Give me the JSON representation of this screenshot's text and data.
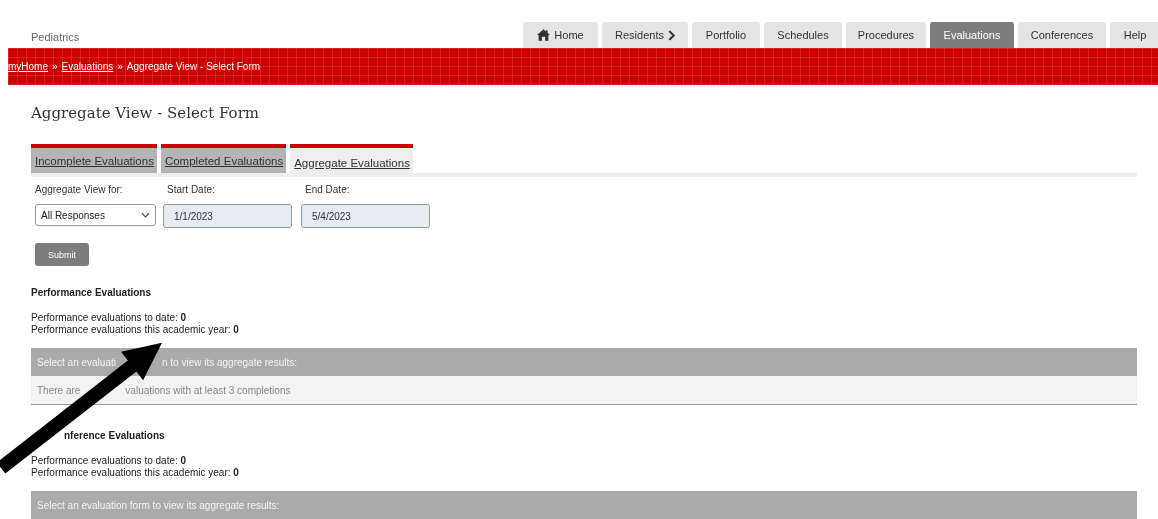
{
  "header": {
    "department": "Pediatrics"
  },
  "nav": [
    {
      "label": "Home",
      "kind": "home",
      "selected": false
    },
    {
      "label": "Residents",
      "kind": "menu",
      "selected": false
    },
    {
      "label": "Portfolio",
      "kind": "plain",
      "selected": false
    },
    {
      "label": "Schedules",
      "kind": "plain",
      "selected": false
    },
    {
      "label": "Procedures",
      "kind": "plain",
      "selected": false
    },
    {
      "label": "Evaluations",
      "kind": "plain",
      "selected": true
    },
    {
      "label": "Conferences",
      "kind": "plain",
      "selected": false
    },
    {
      "label": "Help",
      "kind": "plain",
      "selected": false
    }
  ],
  "breadcrumb": {
    "links": [
      "myHome",
      "Evaluations"
    ],
    "separator": "»",
    "current": "Aggregate View - Select Form"
  },
  "page_title": "Aggregate View - Select Form",
  "tabs": [
    {
      "label": "Incomplete Evaluations",
      "selected": false
    },
    {
      "label": "Completed Evaluations",
      "selected": false
    },
    {
      "label": "Aggregate Evaluations",
      "selected": true
    }
  ],
  "form": {
    "fields": [
      {
        "label": "Aggregate View for:",
        "kind": "select",
        "value": "All Responses"
      },
      {
        "label": "Start Date:",
        "kind": "date",
        "value": "1/1/2023"
      },
      {
        "label": "End Date:",
        "kind": "date",
        "value": "5/4/2023"
      }
    ],
    "submit": "Submit"
  },
  "sections": [
    {
      "title": "Performance Evaluations",
      "stats": [
        {
          "label": "Performance evaluations to date:",
          "value": "0"
        },
        {
          "label": "Performance evaluations this academic year:",
          "value": "0"
        }
      ],
      "table_header": [
        "Select an evaluati",
        "n to view its aggregate results:"
      ],
      "empty_message": [
        "There are",
        "valuations with at least 3 completions"
      ]
    },
    {
      "title": "nference Evaluations",
      "stats": [
        {
          "label": "Performance evaluations to date:",
          "value": "0"
        },
        {
          "label": "Performance evaluations this academic year:",
          "value": "0"
        }
      ],
      "table_header": [
        "Select an evaluation form to view its aggregate results:"
      ]
    }
  ]
}
